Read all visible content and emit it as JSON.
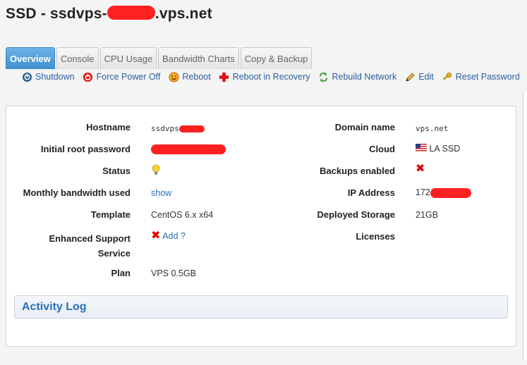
{
  "title": {
    "prefix": "SSD - ssdvps-",
    "suffix": ".vps.net"
  },
  "tabs": [
    {
      "label": "Overview"
    },
    {
      "label": "Console"
    },
    {
      "label": "CPU Usage"
    },
    {
      "label": "Bandwidth Charts"
    },
    {
      "label": "Copy & Backup"
    }
  ],
  "actions": [
    {
      "label": "Shutdown",
      "icon": "power-icon"
    },
    {
      "label": "Force Power Off",
      "icon": "force-power-icon"
    },
    {
      "label": "Reboot",
      "icon": "reboot-icon"
    },
    {
      "label": "Reboot in Recovery",
      "icon": "recovery-cross-icon"
    },
    {
      "label": "Rebuild Network",
      "icon": "rebuild-arrows-icon"
    },
    {
      "label": "Edit",
      "icon": "pencil-icon"
    },
    {
      "label": "Reset Password",
      "icon": "key-icon"
    }
  ],
  "details": {
    "hostname_label": "Hostname",
    "hostname_value": "ssdvps",
    "root_password_label": "Initial root password",
    "root_password_value": "",
    "status_label": "Status",
    "status_icon": "lightbulb-icon",
    "bandwidth_label": "Monthly bandwidth used",
    "bandwidth_link": "show",
    "template_label": "Template",
    "template_value": "CentOS 6.x x64",
    "support_label_line1": "Enhanced Support",
    "support_label_line2": "Service",
    "support_link": "Add ?",
    "plan_label": "Plan",
    "plan_value": "VPS 0.5GB",
    "domain_label": "Domain name",
    "domain_value": "vps.net",
    "cloud_label": "Cloud",
    "cloud_value": "LA SSD",
    "backups_label": "Backups enabled",
    "ip_label": "IP Address",
    "ip_value": "172",
    "storage_label": "Deployed Storage",
    "storage_value": "21GB",
    "licenses_label": "Licenses"
  },
  "activity_log": {
    "title": "Activity Log"
  },
  "colors": {
    "accent": "#3f8fcf",
    "link": "#2a6fb8",
    "danger": "#e00000"
  }
}
